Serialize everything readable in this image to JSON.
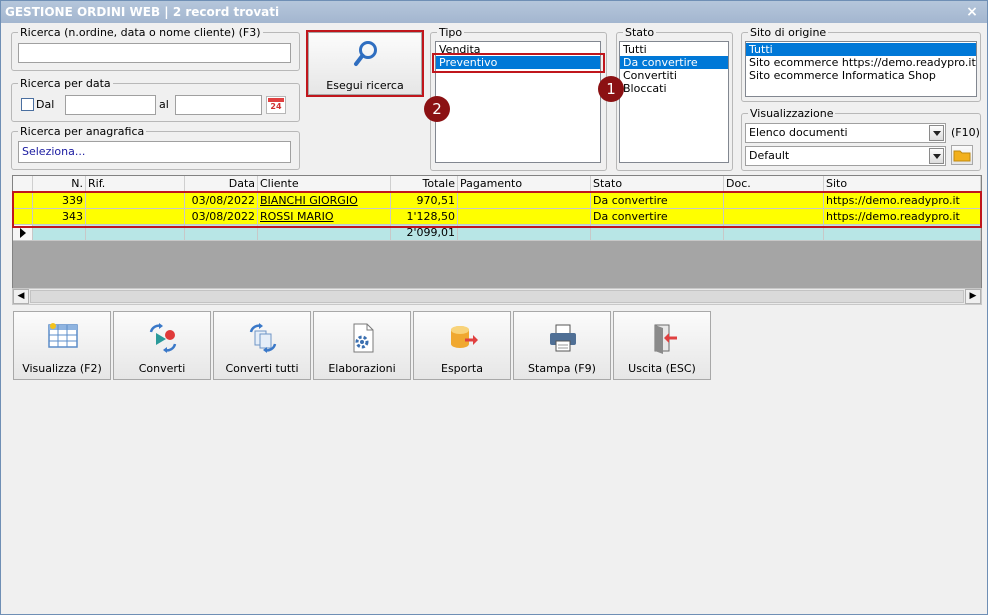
{
  "window": {
    "title": "GESTIONE ORDINI WEB | 2 record trovati",
    "close": "×"
  },
  "search": {
    "group_label": "Ricerca (n.ordine, data o nome cliente) (F3)",
    "value": "",
    "button_label": "Esegui ricerca"
  },
  "date_search": {
    "group_label": "Ricerca per data",
    "from_label": "Dal",
    "to_label": "al",
    "from_value": "",
    "to_value": "",
    "calendar_day": "24"
  },
  "anagrafica": {
    "group_label": "Ricerca per anagrafica",
    "value": "Seleziona..."
  },
  "tipo": {
    "group_label": "Tipo",
    "items": [
      "Vendita",
      "Preventivo"
    ],
    "selected": 1
  },
  "stato": {
    "group_label": "Stato",
    "items": [
      "Tutti",
      "Da convertire",
      "Convertiti",
      "Bloccati"
    ],
    "selected": 1
  },
  "sito_origine": {
    "group_label": "Sito di origine",
    "items": [
      "Tutti",
      "Sito ecommerce https://demo.readypro.it",
      "Sito ecommerce Informatica Shop"
    ],
    "selected": 0
  },
  "visualizzazione": {
    "group_label": "Visualizzazione",
    "combo1": "Elenco documenti",
    "combo2": "Default",
    "shortcut": "(F10)"
  },
  "callouts": {
    "one": "1",
    "two": "2"
  },
  "grid": {
    "columns": [
      "",
      "N.",
      "Rif.",
      "Data",
      "Cliente",
      "Totale",
      "Pagamento",
      "Stato",
      "Doc.",
      "Sito"
    ],
    "rows": [
      {
        "n": "339",
        "rif": "",
        "data": "03/08/2022",
        "cliente": "BIANCHI GIORGIO",
        "totale": "970,51",
        "pagamento": "",
        "stato": "Da convertire",
        "doc": "",
        "sito": "https://demo.readypro.it"
      },
      {
        "n": "343",
        "rif": "",
        "data": "03/08/2022",
        "cliente": "ROSSI MARIO",
        "totale": "1'128,50",
        "pagamento": "",
        "stato": "Da convertire",
        "doc": "",
        "sito": "https://demo.readypro.it"
      }
    ],
    "total": "2'099,01"
  },
  "actions": [
    {
      "label": "Visualizza (F2)",
      "icon": "grid-view-icon"
    },
    {
      "label": "Converti",
      "icon": "convert-icon"
    },
    {
      "label": "Converti tutti",
      "icon": "convert-all-icon"
    },
    {
      "label": "Elaborazioni",
      "icon": "process-document-icon"
    },
    {
      "label": "Esporta",
      "icon": "export-database-icon"
    },
    {
      "label": "Stampa (F9)",
      "icon": "printer-icon"
    },
    {
      "label": "Uscita (ESC)",
      "icon": "exit-door-icon"
    }
  ],
  "colors": {
    "selection": "#0078d7",
    "row_highlight": "#ffff00",
    "total_row": "#b8e6e6",
    "callout": "#8b1113",
    "annotation_border": "#c0161c"
  }
}
